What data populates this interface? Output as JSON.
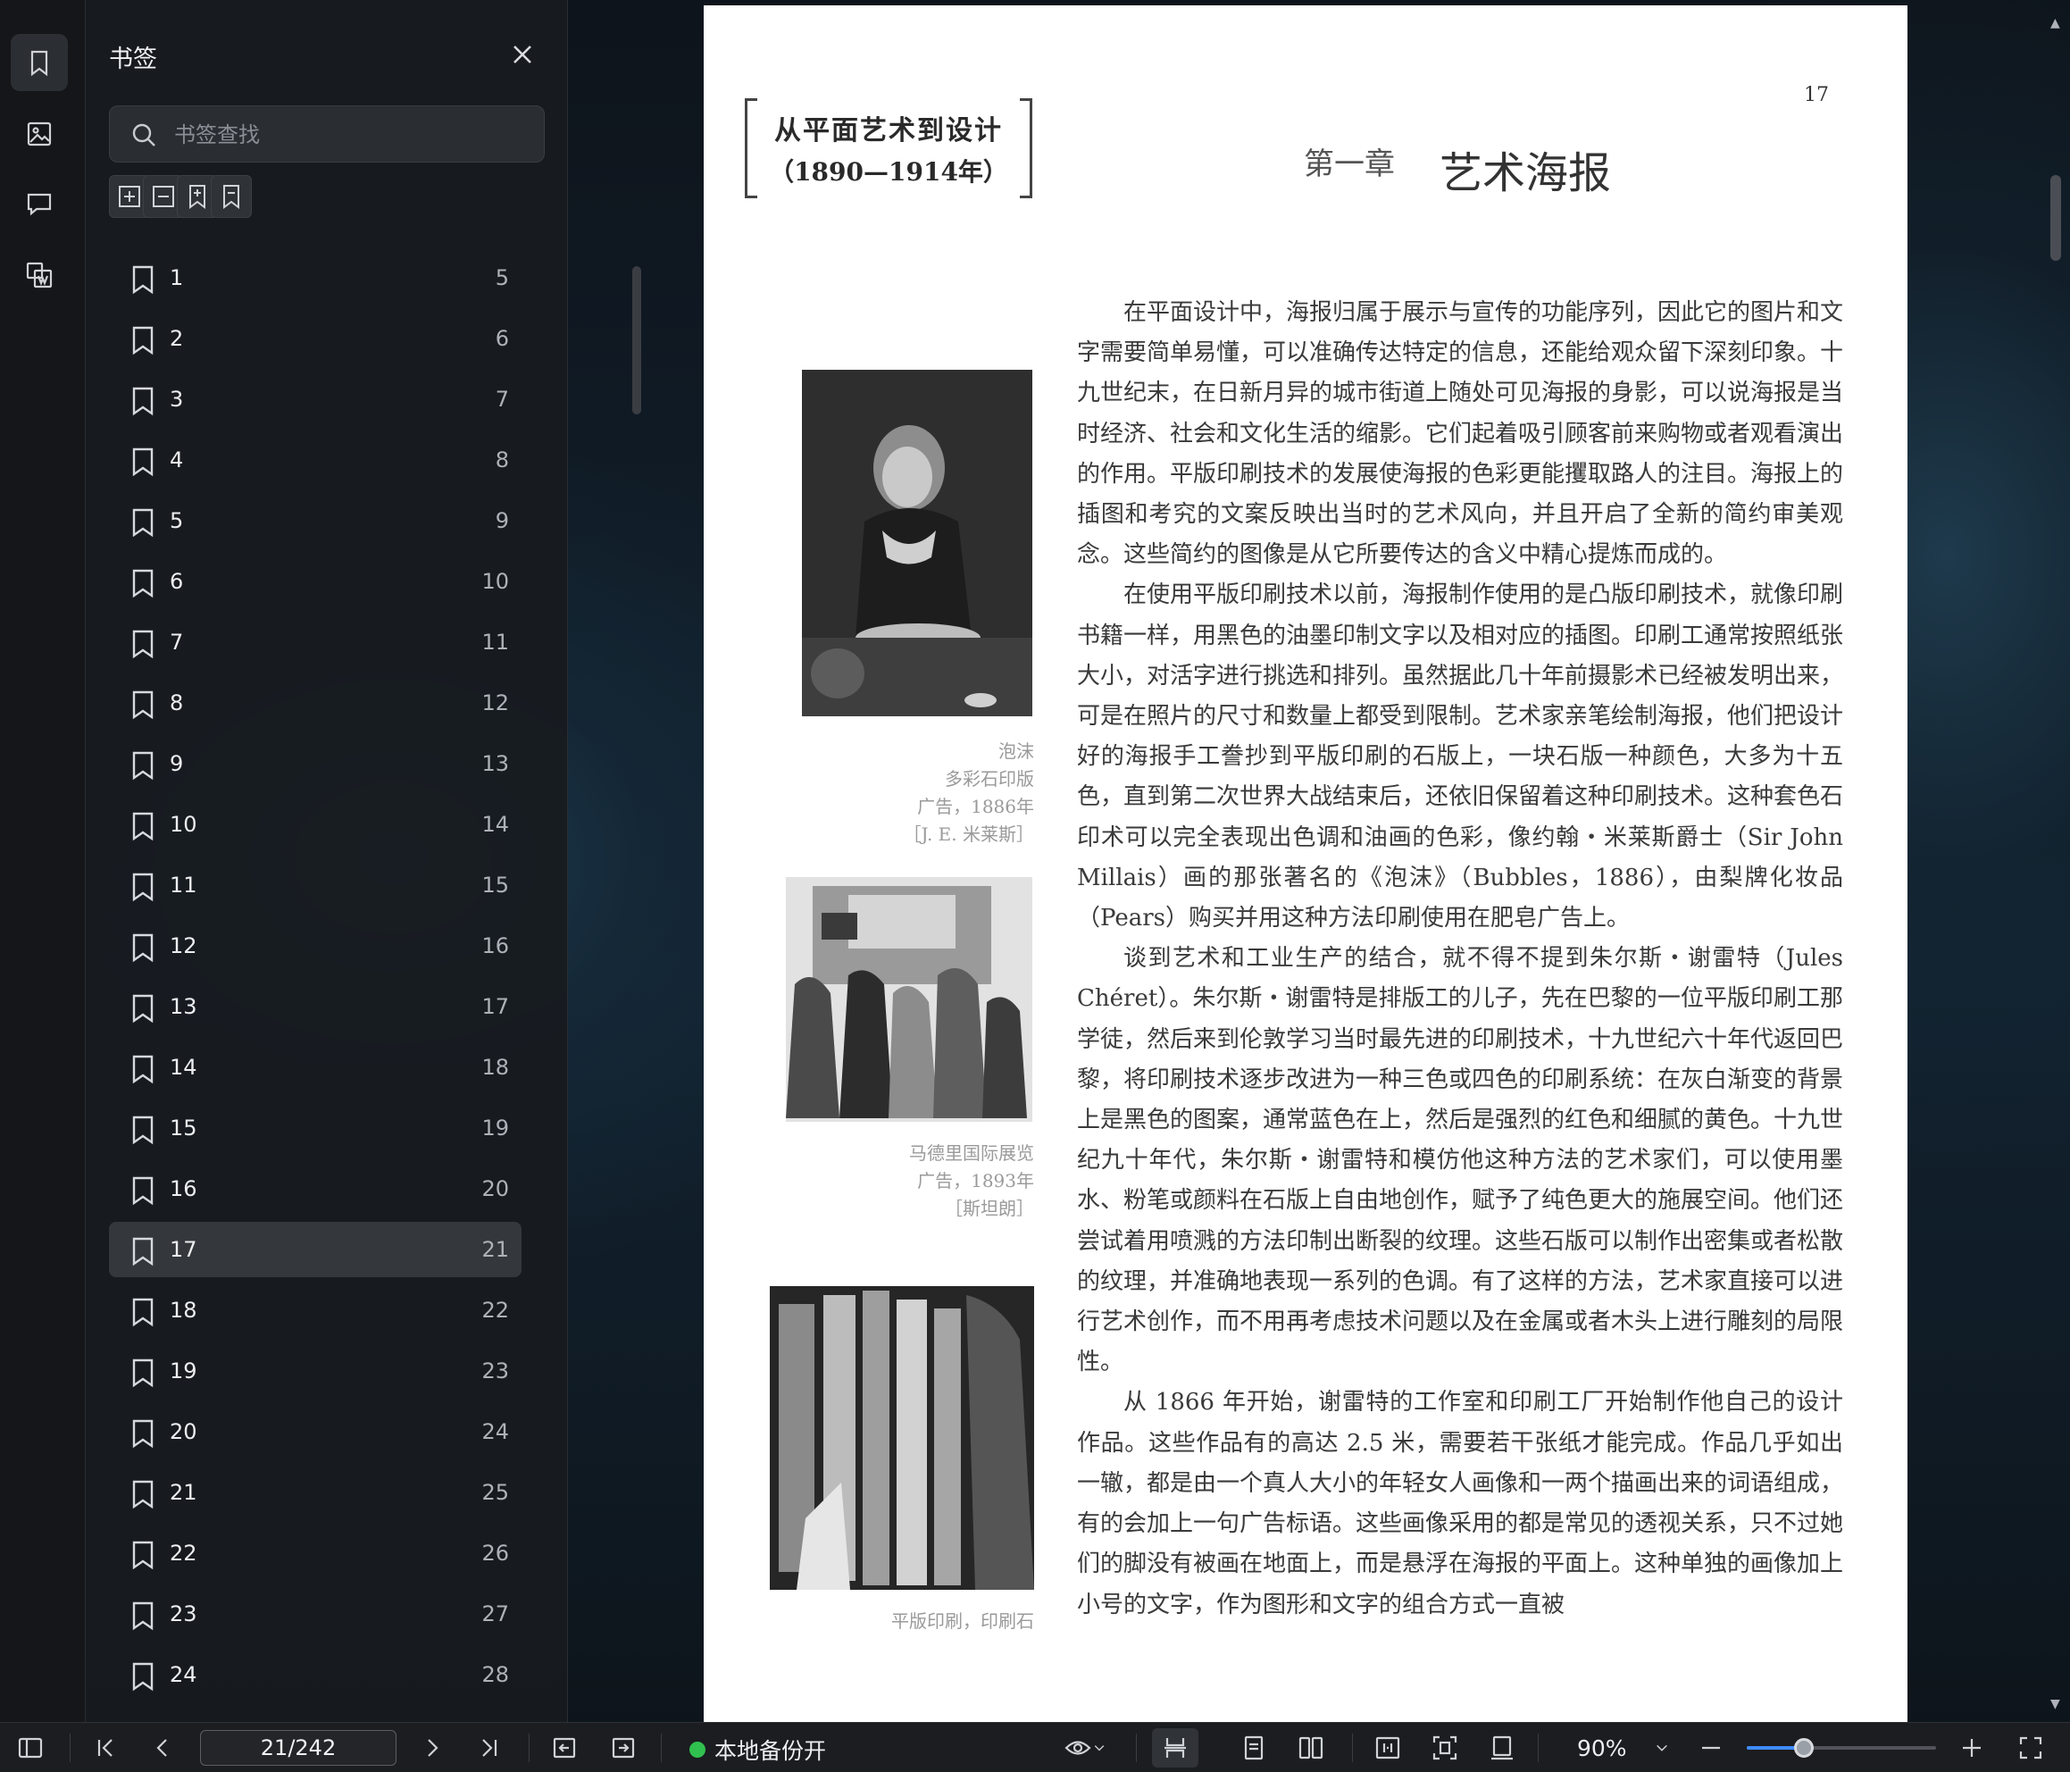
{
  "bookmarks_panel": {
    "title": "书签",
    "search_placeholder": "书签查找",
    "items": [
      {
        "label": "1",
        "page": "5"
      },
      {
        "label": "2",
        "page": "6"
      },
      {
        "label": "3",
        "page": "7"
      },
      {
        "label": "4",
        "page": "8"
      },
      {
        "label": "5",
        "page": "9"
      },
      {
        "label": "6",
        "page": "10"
      },
      {
        "label": "7",
        "page": "11"
      },
      {
        "label": "8",
        "page": "12"
      },
      {
        "label": "9",
        "page": "13"
      },
      {
        "label": "10",
        "page": "14"
      },
      {
        "label": "11",
        "page": "15"
      },
      {
        "label": "12",
        "page": "16"
      },
      {
        "label": "13",
        "page": "17"
      },
      {
        "label": "14",
        "page": "18"
      },
      {
        "label": "15",
        "page": "19"
      },
      {
        "label": "16",
        "page": "20"
      },
      {
        "label": "17",
        "page": "21",
        "selected": true
      },
      {
        "label": "18",
        "page": "22"
      },
      {
        "label": "19",
        "page": "23"
      },
      {
        "label": "20",
        "page": "24"
      },
      {
        "label": "21",
        "page": "25"
      },
      {
        "label": "22",
        "page": "26"
      },
      {
        "label": "23",
        "page": "27"
      },
      {
        "label": "24",
        "page": "28"
      }
    ]
  },
  "document": {
    "page_number": "17",
    "banner_line1": "从平面艺术到设计",
    "banner_line2": "（1890—1914年）",
    "chapter_no": "第一章",
    "chapter_title": "艺术海报",
    "captions": {
      "c1": [
        "泡沫",
        "多彩石印版",
        "广告，1886年",
        "［J. E. 米莱斯］"
      ],
      "c2": [
        "马德里国际展览",
        "广告，1893年",
        "［斯坦朗］"
      ],
      "c3": [
        "平版印刷，印刷石"
      ]
    },
    "paragraphs": [
      "在平面设计中，海报归属于展示与宣传的功能序列，因此它的图片和文字需要简单易懂，可以准确传达特定的信息，还能给观众留下深刻印象。十九世纪末，在日新月异的城市街道上随处可见海报的身影，可以说海报是当时经济、社会和文化生活的缩影。它们起着吸引顾客前来购物或者观看演出的作用。平版印刷技术的发展使海报的色彩更能攫取路人的注目。海报上的插图和考究的文案反映出当时的艺术风向，并且开启了全新的简约审美观念。这些简约的图像是从它所要传达的含义中精心提炼而成的。",
      "在使用平版印刷技术以前，海报制作使用的是凸版印刷技术，就像印刷书籍一样，用黑色的油墨印制文字以及相对应的插图。印刷工通常按照纸张大小，对活字进行挑选和排列。虽然据此几十年前摄影术已经被发明出来，可是在照片的尺寸和数量上都受到限制。艺术家亲笔绘制海报，他们把设计好的海报手工誊抄到平版印刷的石版上，一块石版一种颜色，大多为十五色，直到第二次世界大战结束后，还依旧保留着这种印刷技术。这种套色石印术可以完全表现出色调和油画的色彩，像约翰・米莱斯爵士（Sir John Millais）画的那张著名的《泡沫》（Bubbles，1886），由梨牌化妆品（Pears）购买并用这种方法印刷使用在肥皂广告上。",
      "谈到艺术和工业生产的结合，就不得不提到朱尔斯・谢雷特（Jules Chéret）。朱尔斯・谢雷特是排版工的儿子，先在巴黎的一位平版印刷工那学徒，然后来到伦敦学习当时最先进的印刷技术，十九世纪六十年代返回巴黎，将印刷技术逐步改进为一种三色或四色的印刷系统：在灰白渐变的背景上是黑色的图案，通常蓝色在上，然后是强烈的红色和细腻的黄色。十九世纪九十年代，朱尔斯・谢雷特和模仿他这种方法的艺术家们，可以使用墨水、粉笔或颜料在石版上自由地创作，赋予了纯色更大的施展空间。他们还尝试着用喷溅的方法印制出断裂的纹理。这些石版可以制作出密集或者松散的纹理，并准确地表现一系列的色调。有了这样的方法，艺术家直接可以进行艺术创作，而不用再考虑技术问题以及在金属或者木头上进行雕刻的局限性。",
      "从 1866 年开始，谢雷特的工作室和印刷工厂开始制作他自己的设计作品。这些作品有的高达 2.5 米，需要若干张纸才能完成。作品几乎如出一辙，都是由一个真人大小的年轻女人画像和一两个描画出来的词语组成，有的会加上一句广告标语。这些画像采用的都是常见的透视关系，只不过她们的脚没有被画在地面上，而是悬浮在海报的平面上。这种单独的画像加上小号的文字，作为图形和文字的组合方式一直被"
    ]
  },
  "toolbar": {
    "page_indicator": "21/242",
    "backup_label": "本地备份开",
    "zoom_label": "90%",
    "zoom_level": 0.3
  },
  "colors": {
    "accent": "#3f8cff",
    "backup_dot": "#30c04f",
    "panel_bg": "#181b1f"
  }
}
